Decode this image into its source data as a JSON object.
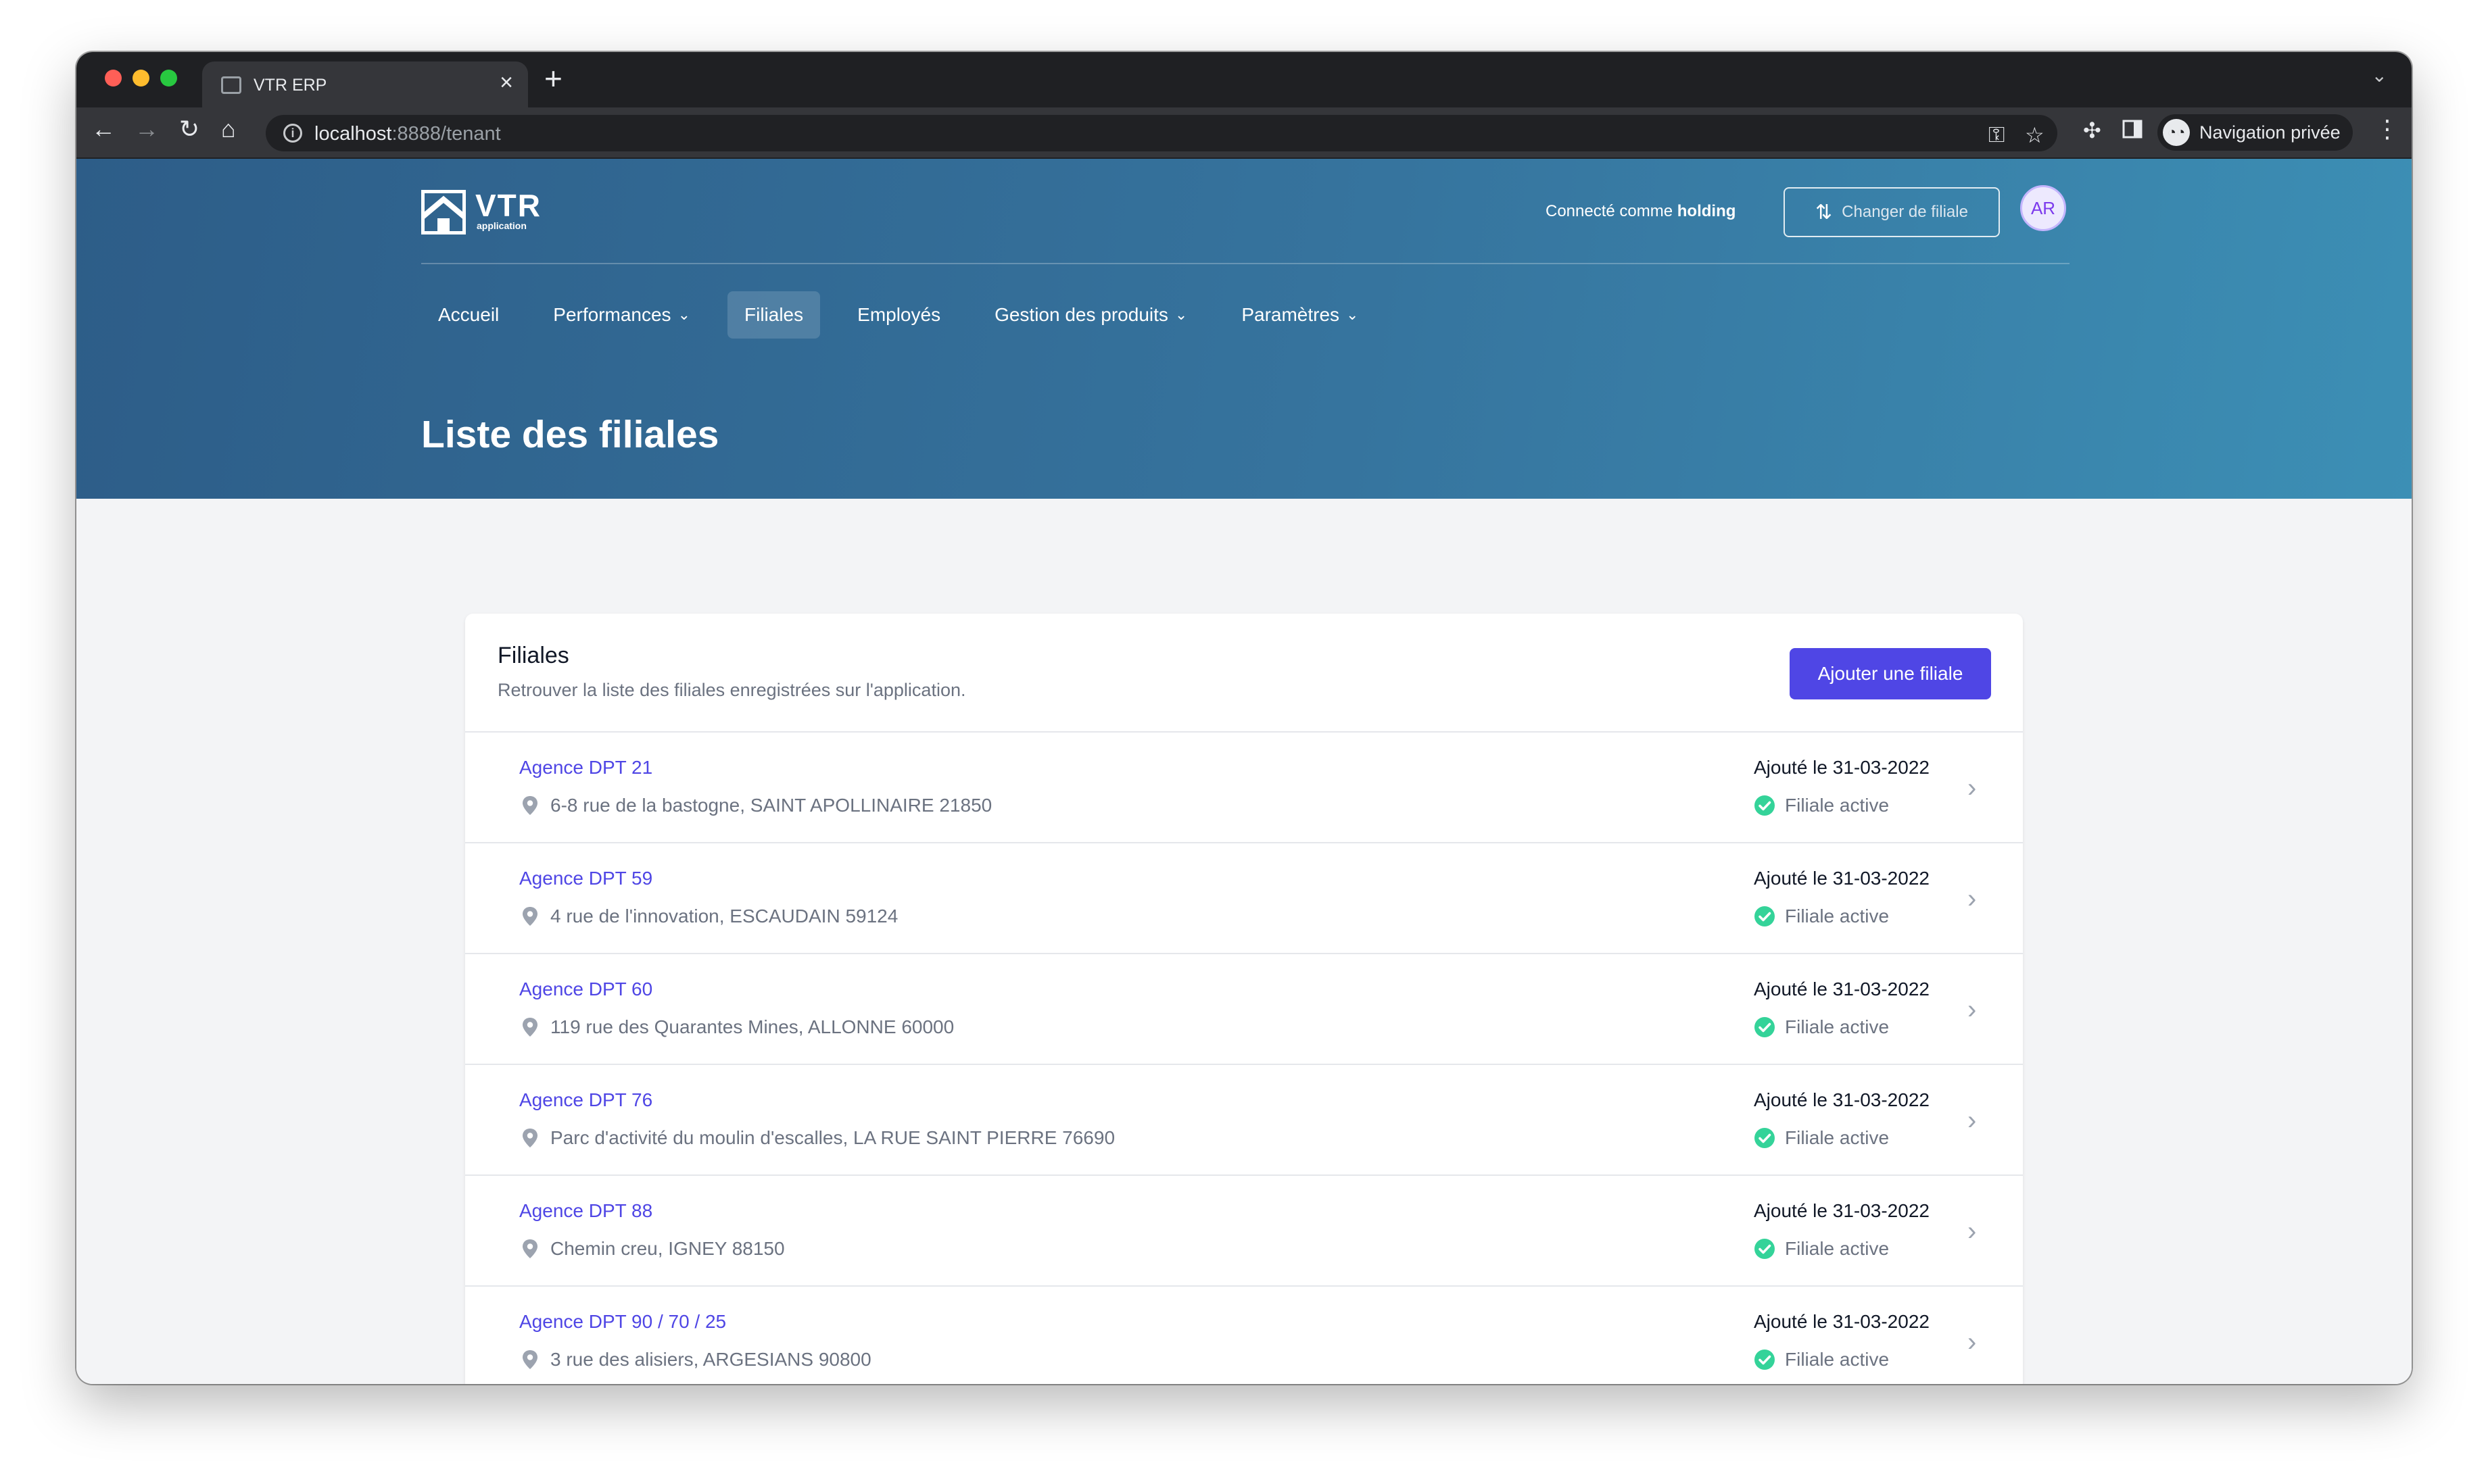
{
  "browser": {
    "tab_title": "VTR ERP",
    "close_glyph": "×",
    "newtab_glyph": "+",
    "url_host": "localhost",
    "url_rest": ":8888/tenant",
    "profile_label": "Navigation privée"
  },
  "header": {
    "logo_text": "VTR",
    "logo_sub": "application",
    "connected_prefix": "Connecté comme ",
    "connected_role": "holding",
    "switch_label": "Changer de filiale",
    "avatar_initials": "AR"
  },
  "nav": {
    "items": [
      {
        "label": "Accueil"
      },
      {
        "label": "Performances"
      },
      {
        "label": "Filiales"
      },
      {
        "label": "Employés"
      },
      {
        "label": "Gestion des produits"
      },
      {
        "label": "Paramètres"
      }
    ]
  },
  "page": {
    "title": "Liste des filiales"
  },
  "card": {
    "title": "Filiales",
    "subtitle": "Retrouver la liste des filiales enregistrées sur l'application.",
    "add_label": "Ajouter une filiale"
  },
  "rows": [
    {
      "name": "Agence DPT 21",
      "address": "6-8 rue de la bastogne, SAINT APOLLINAIRE 21850",
      "date": "Ajouté le 31-03-2022",
      "status": "Filiale active"
    },
    {
      "name": "Agence DPT 59",
      "address": "4 rue de l'innovation, ESCAUDAIN 59124",
      "date": "Ajouté le 31-03-2022",
      "status": "Filiale active"
    },
    {
      "name": "Agence DPT 60",
      "address": "119 rue des Quarantes Mines, ALLONNE 60000",
      "date": "Ajouté le 31-03-2022",
      "status": "Filiale active"
    },
    {
      "name": "Agence DPT 76",
      "address": "Parc d'activité du moulin d'escalles, LA RUE SAINT PIERRE 76690",
      "date": "Ajouté le 31-03-2022",
      "status": "Filiale active"
    },
    {
      "name": "Agence DPT 88",
      "address": "Chemin creu, IGNEY 88150",
      "date": "Ajouté le 31-03-2022",
      "status": "Filiale active"
    },
    {
      "name": "Agence DPT 90 / 70 / 25",
      "address": "3 rue des alisiers, ARGESIANS 90800",
      "date": "Ajouté le 31-03-2022",
      "status": "Filiale active"
    }
  ],
  "colors": {
    "accent": "#4f46e5",
    "success": "#34d399",
    "hero_start": "#2d5d88",
    "hero_end": "#3c8fb5"
  },
  "icons": {
    "row_location": "map-pin-icon",
    "row_status": "check-circle-icon",
    "row_chevron": "chevron-right-icon"
  }
}
